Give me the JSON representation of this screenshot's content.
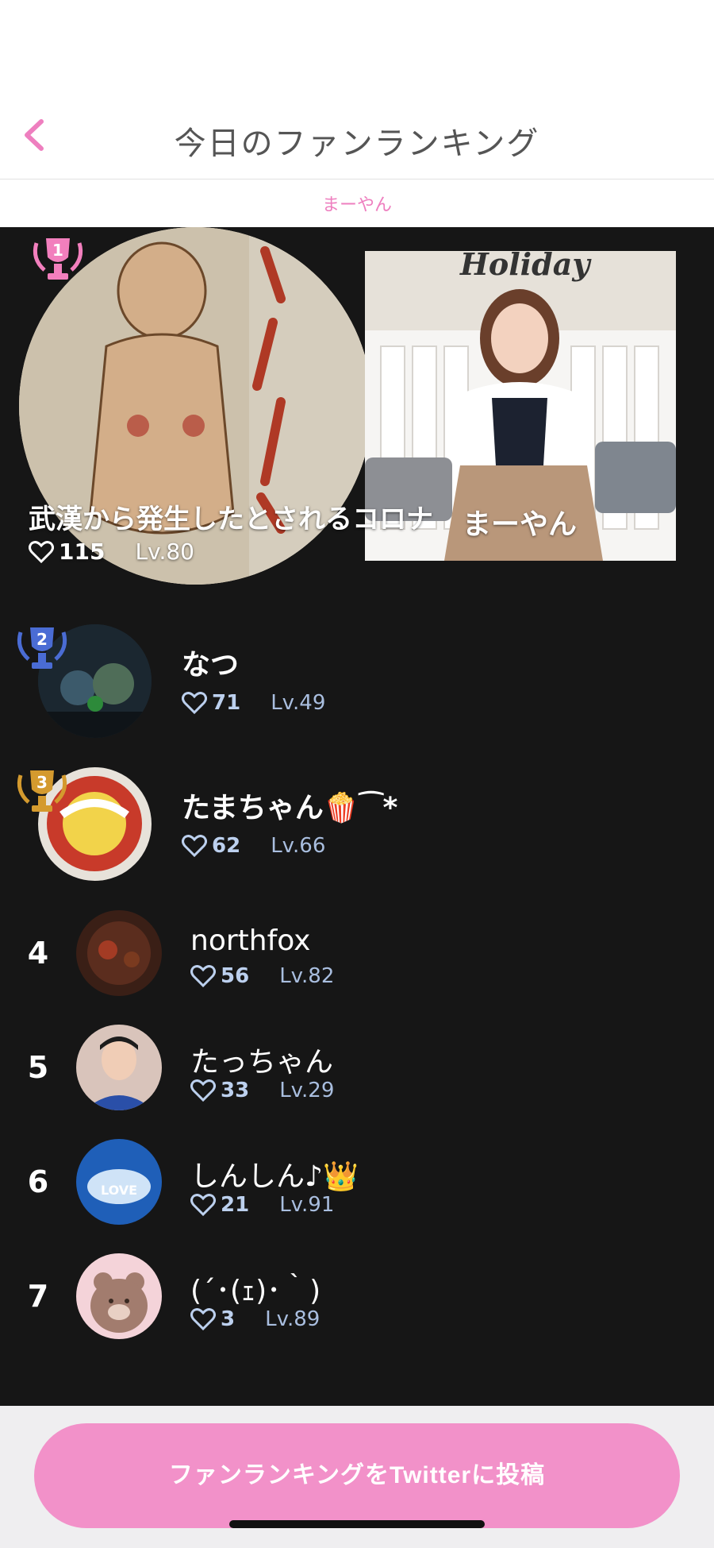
{
  "header": {
    "title": "今日のファンランキング",
    "back_icon": "chevron-left-icon",
    "accent_color": "#ee7fbf"
  },
  "subbar": {
    "host_label": "まーやん"
  },
  "first_place": {
    "rank": "1",
    "name": "武漢から発生したとされるコロナ",
    "likes": "115",
    "level": "Lv.80",
    "host_name": "まーやん",
    "host_photo_text": "Holiday"
  },
  "ranking": [
    {
      "rank": "2",
      "name": "なつ",
      "likes": "71",
      "level": "Lv.49"
    },
    {
      "rank": "3",
      "name": "たまちゃん🍿⁀*",
      "likes": "62",
      "level": "Lv.66"
    },
    {
      "rank": "4",
      "name": "northfox",
      "likes": "56",
      "level": "Lv.82"
    },
    {
      "rank": "5",
      "name": "たっちゃん",
      "likes": "33",
      "level": "Lv.29"
    },
    {
      "rank": "6",
      "name": "しんしん♪👑",
      "likes": "21",
      "level": "Lv.91"
    },
    {
      "rank": "7",
      "name": "(´･(ｪ)･｀)",
      "likes": "3",
      "level": "Lv.89"
    }
  ],
  "avatar_labels": {
    "rank6_text": "LOVE"
  },
  "footer": {
    "share_label": "ファンランキングをTwitterに投稿",
    "button_color": "#f291c9"
  },
  "trophy_colors": {
    "gold_pink": "#f27fbd",
    "blue": "#4a6cd4",
    "bronze": "#d49a2e"
  }
}
